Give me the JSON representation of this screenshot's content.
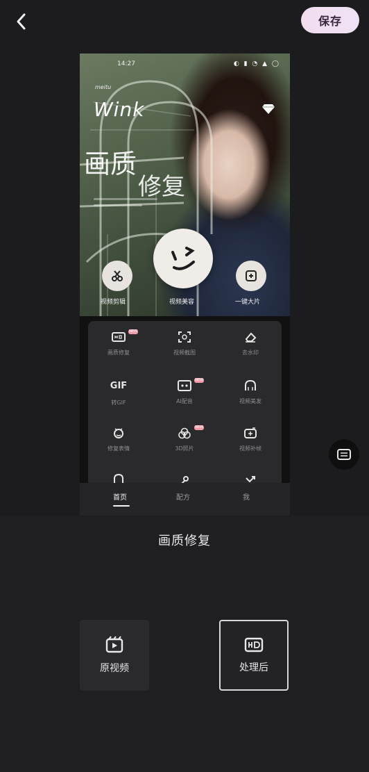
{
  "header": {
    "save_label": "保存"
  },
  "preview": {
    "status_time": "14:27",
    "status_icons": "◐ ▮ ◔ ▲ ◯",
    "brand_small": "meitu",
    "brand_logo": "Wink",
    "title_line1": "画质",
    "title_line2": "修复",
    "captions": {
      "left": "视频剪辑",
      "center": "视频美容",
      "right": "一键大片"
    },
    "tools": [
      {
        "label": "画质修复",
        "icon": "hd-icon",
        "badge": "NEW"
      },
      {
        "label": "视频截图",
        "icon": "scan-icon",
        "badge": ""
      },
      {
        "label": "去水印",
        "icon": "eraser-icon",
        "badge": ""
      },
      {
        "label": "转GIF",
        "icon": "gif-icon",
        "badge": ""
      },
      {
        "label": "AI配音",
        "icon": "ai-icon",
        "badge": "NEW"
      },
      {
        "label": "视频美发",
        "icon": "hair-icon",
        "badge": ""
      },
      {
        "label": "修复表情",
        "icon": "face-icon",
        "badge": ""
      },
      {
        "label": "3D照片",
        "icon": "3d-icon",
        "badge": "NEW"
      },
      {
        "label": "视频补帧",
        "icon": "frame-icon",
        "badge": ""
      }
    ],
    "tabs": [
      "首页",
      "配方",
      "我"
    ]
  },
  "feature": {
    "title": "画质修复"
  },
  "modes": {
    "original_label": "原视频",
    "processed_label": "处理后"
  },
  "colors": {
    "save_gradient_start": "#f3ddf0",
    "badge": "#f29aa6",
    "background": "#1f1f21"
  }
}
